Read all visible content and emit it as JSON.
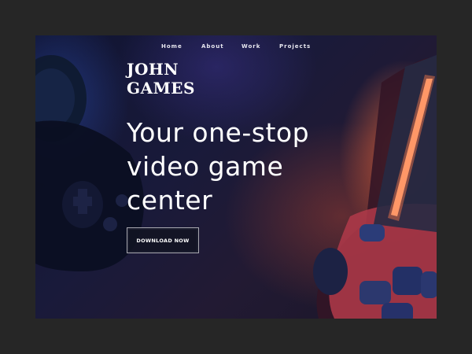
{
  "nav": {
    "items": [
      {
        "label": "Home"
      },
      {
        "label": "About"
      },
      {
        "label": "Work"
      },
      {
        "label": "Projects"
      }
    ]
  },
  "brand": {
    "line1": "JOHN",
    "line2": "GAMES"
  },
  "hero": {
    "headline_lines": [
      "Your one-stop",
      "video game",
      "center"
    ],
    "cta_label": "DOWNLOAD NOW"
  },
  "colors": {
    "page_background": "#262626",
    "hero_background": "#191a3a",
    "accent_glow": "#ff6e3c",
    "led_strip": "#ff8a5c",
    "text": "#ffffff"
  },
  "background_image": {
    "subject": "game controllers in dark blue and orange light",
    "icons": [
      "left-controller-icon",
      "right-controller-icon"
    ]
  }
}
